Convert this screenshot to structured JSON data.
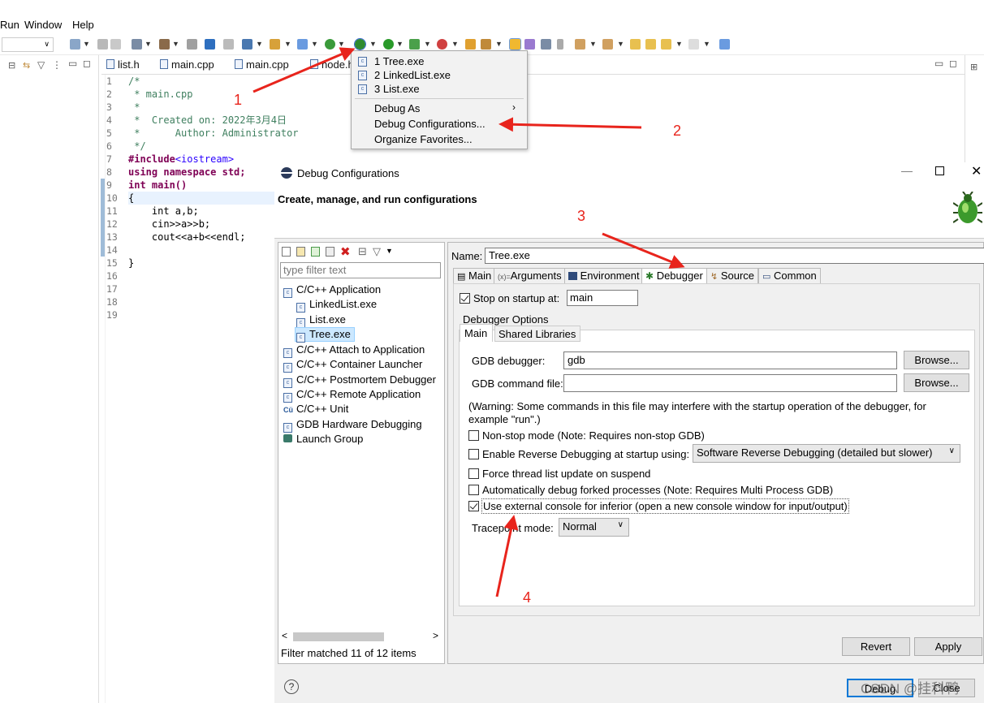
{
  "menubar": {
    "items": [
      "Run",
      "Window",
      "Help"
    ]
  },
  "editor_tabs": [
    "list.h",
    "main.cpp",
    "main.cpp",
    "node.h"
  ],
  "code": {
    "line_numbers": [
      "1",
      "2",
      "3",
      "4",
      "5",
      "6",
      "7",
      "8",
      "9",
      "10",
      "11",
      "12",
      "13",
      "14",
      "15",
      "16",
      "17",
      "18",
      "19"
    ],
    "lines": [
      "/*",
      " * main.cpp",
      " *",
      " *  Created on: 2022年3月4日",
      " *      Author: Administrator",
      " */",
      "#include<iostream>",
      "using namespace std;",
      "int main()",
      "{",
      "    int a,b;",
      "    cin>>a>>b;",
      "    cout<<a+b<<endl;",
      "",
      "}"
    ]
  },
  "dropdown_menu": {
    "items": [
      "1 Tree.exe",
      "2 LinkedList.exe",
      "3 List.exe"
    ],
    "debug_as": "Debug As",
    "debug_configurations": "Debug Configurations...",
    "organize_favorites": "Organize Favorites..."
  },
  "dialog": {
    "title": "Debug Configurations",
    "header": "Create, manage, and run configurations",
    "filter_placeholder": "type filter text",
    "tree": {
      "cpp_application": "C/C++ Application",
      "children": [
        "LinkedList.exe",
        "List.exe",
        "Tree.exe"
      ],
      "others": [
        "C/C++ Attach to Application",
        "C/C++ Container Launcher",
        "C/C++ Postmortem Debugger",
        "C/C++ Remote Application",
        "C/C++ Unit",
        "GDB Hardware Debugging",
        "Launch Group"
      ]
    },
    "filter_status": "Filter matched 11 of 12 items",
    "name_label": "Name:",
    "name_value": "Tree.exe",
    "tabs": [
      "Main",
      "Arguments",
      "Environment",
      "Debugger",
      "Source",
      "Common"
    ],
    "stop_on_startup_label": "Stop on startup at:",
    "stop_on_startup_value": "main",
    "debugger_options": "Debugger Options",
    "subtabs": [
      "Main",
      "Shared Libraries"
    ],
    "gdb_debugger_label": "GDB debugger:",
    "gdb_debugger_value": "gdb",
    "gdb_command_file_label": "GDB command file:",
    "gdb_command_file_value": "",
    "browse": "Browse...",
    "warning": "(Warning: Some commands in this file may interfere with the startup operation of the debugger, for example \"run\".)",
    "options": [
      {
        "label": "Non-stop mode (Note: Requires non-stop GDB)",
        "checked": false
      },
      {
        "label": "Enable Reverse Debugging at startup using:",
        "checked": false
      },
      {
        "label": "Force thread list update on suspend",
        "checked": false
      },
      {
        "label": "Automatically debug forked processes (Note: Requires Multi Process GDB)",
        "checked": false
      },
      {
        "label": "Use external console for inferior (open a new console window for input/output)",
        "checked": true
      }
    ],
    "reverse_mode_value": "Software Reverse Debugging (detailed but slower)",
    "tracepoint_label": "Tracepoint mode:",
    "tracepoint_value": "Normal",
    "revert": "Revert",
    "apply": "Apply",
    "debug": "Debug",
    "close": "Close",
    "help": "?"
  },
  "annotations": [
    "1",
    "2",
    "3",
    "4"
  ],
  "watermark": "CSDN @挂科鸭",
  "colors": {
    "annotation_red": "#e8241c",
    "selection_blue": "#cce8ff",
    "comment_green": "#3f7f5f",
    "keyword_purple": "#7f0055"
  }
}
